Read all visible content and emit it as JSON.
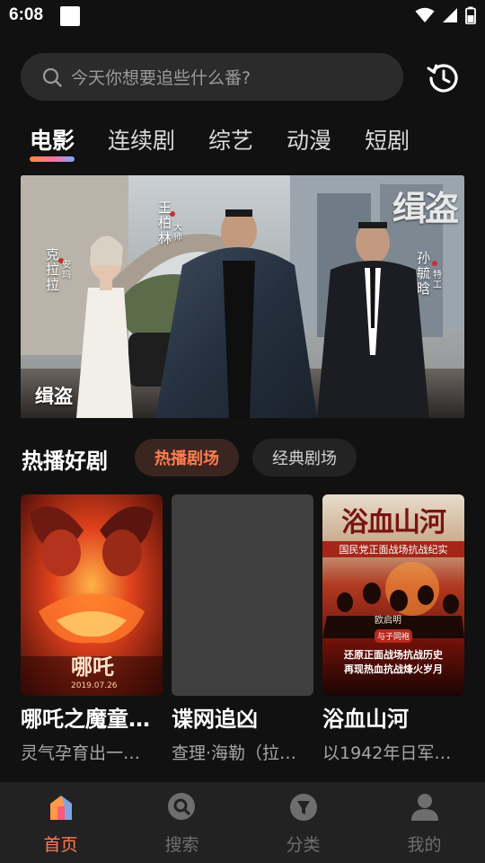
{
  "status_bar": {
    "time": "6:08"
  },
  "search": {
    "placeholder": "今天你想要追些什么番?"
  },
  "tabs": [
    {
      "label": "电影",
      "active": true
    },
    {
      "label": "连续剧",
      "active": false
    },
    {
      "label": "综艺",
      "active": false
    },
    {
      "label": "动漫",
      "active": false
    },
    {
      "label": "短剧",
      "active": false
    }
  ],
  "banner": {
    "title": "缉盗",
    "logo_text": "缉盗",
    "cast": [
      {
        "name": "克拉拉",
        "role": "安玛"
      },
      {
        "name": "王柏林",
        "role": "大师"
      },
      {
        "name": "孙毓晗",
        "role": "特工"
      }
    ]
  },
  "section": {
    "title": "热播好剧",
    "chips": [
      {
        "label": "热播剧场",
        "active": true
      },
      {
        "label": "经典剧场",
        "active": false
      }
    ]
  },
  "cards": [
    {
      "title": "哪吒之魔童…",
      "subtitle": "灵气孕育出一…",
      "poster_logo": "哪吒",
      "poster_date": "2019.07.26"
    },
    {
      "title": "谍网追凶",
      "subtitle": "查理·海勒（拉…"
    },
    {
      "title": "浴血山河",
      "subtitle": "以1942年日军…",
      "poster_title": "浴血山河",
      "poster_tagline": "国民党正面战场抗战纪实",
      "poster_author": "欧启明",
      "poster_badge": "与子同袍",
      "poster_line1": "还原正面战场抗战历史",
      "poster_line2": "再现热血抗战烽火岁月"
    }
  ],
  "bottom_nav": [
    {
      "label": "首页",
      "icon": "home-icon",
      "active": true
    },
    {
      "label": "搜索",
      "icon": "search-icon",
      "active": false
    },
    {
      "label": "分类",
      "icon": "category-icon",
      "active": false
    },
    {
      "label": "我的",
      "icon": "profile-icon",
      "active": false
    }
  ],
  "colors": {
    "background": "#111111",
    "accent": "#ff7d50",
    "search_bg": "#2b2b2b",
    "nav_bg": "#222222"
  }
}
